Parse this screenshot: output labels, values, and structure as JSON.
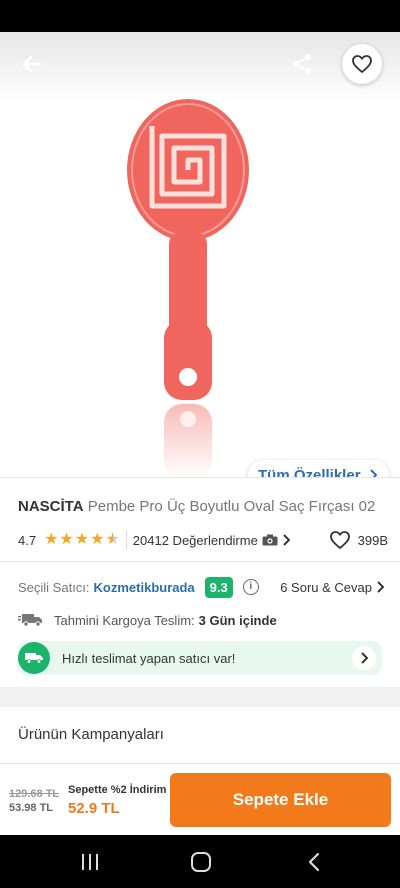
{
  "header": {
    "back_icon": "arrow-left-icon",
    "share_icon": "share-icon",
    "favorite_icon": "heart-outline-icon"
  },
  "gallery": {
    "all_features_label": "Tüm Özellikler"
  },
  "product": {
    "brand": "NASCİTA",
    "name": "Pembe Pro Üç Boyutlu Oval Saç Fırçası 02",
    "rating": "4.7",
    "star_count": 4.5,
    "review_count_label": "20412 Değerlendirme",
    "favorite_count": "399B"
  },
  "seller": {
    "label": "Seçili Satıcı:",
    "name": "Kozmetikburada",
    "score": "9.3",
    "qa_label": "6 Soru & Cevap"
  },
  "shipping": {
    "label": "Tahmini Kargoya Teslim:",
    "days": "3 Gün içinde",
    "fast_delivery_text": "Hızlı teslimat yapan satıcı var!"
  },
  "campaigns": {
    "title": "Ürünün Kampanyaları"
  },
  "bottom_bar": {
    "old_price": "129.68 TL",
    "mid_price": "53.98 TL",
    "promo_label": "Sepette %2 İndirim",
    "final_price": "52.9 TL",
    "add_to_cart_label": "Sepete Ekle"
  },
  "colors": {
    "accent_orange": "#f27a1a",
    "link_blue": "#2a6db0",
    "success_green": "#1cb36b",
    "star_yellow": "#f5a623",
    "product_coral": "#f0665e"
  }
}
